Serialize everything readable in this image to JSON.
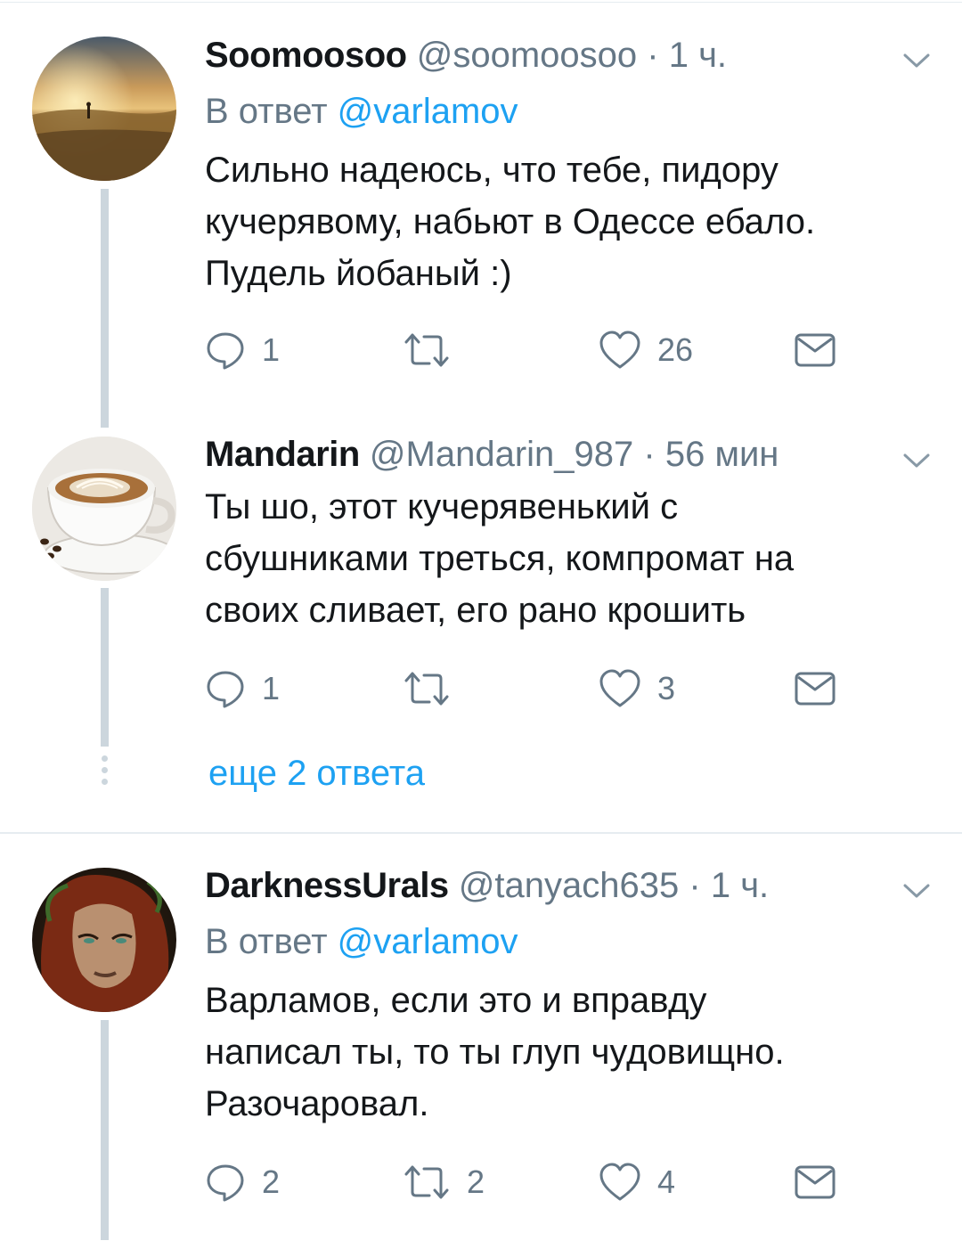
{
  "colors": {
    "text": "#14171a",
    "secondary": "#657786",
    "link": "#1da1f2",
    "thread_line": "#ccd6dd",
    "divider": "#e6ecf0"
  },
  "tweets": [
    {
      "display_name": "Soomoosoo",
      "handle": "@soomoosoo",
      "separator": "·",
      "time": "1 ч.",
      "reply_prefix": "В ответ",
      "reply_mention": "@varlamov",
      "text_lines": [
        "Сильно надеюсь, что тебе, пидору",
        "кучерявому, набьют в Одессе ебало.",
        "Пудель йобаный :)"
      ],
      "reply_count": "1",
      "retweet_count": "",
      "like_count": "26",
      "icons": [
        "reply-icon",
        "retweet-icon",
        "like-icon",
        "direct-message-icon",
        "chevron-down-icon"
      ]
    },
    {
      "display_name": "Mandarin",
      "handle": "@Mandarin_987",
      "separator": "·",
      "time": "56 мин",
      "text_lines": [
        "Ты шо, этот кучерявенький с",
        "сбушниками треться, компромат на",
        "своих сливает, его рано крошить"
      ],
      "reply_count": "1",
      "retweet_count": "",
      "like_count": "3"
    },
    {
      "display_name": "DarknessUrals",
      "handle": "@tanyach635",
      "separator": "·",
      "time": "1 ч.",
      "reply_prefix": "В ответ",
      "reply_mention": "@varlamov",
      "text_lines": [
        "Варламов, если это и вправду",
        "написал ты, то ты глуп чудовищно.",
        "Разочаровал."
      ],
      "reply_count": "2",
      "retweet_count": "2",
      "like_count": "4"
    }
  ],
  "more_replies": "еще 2 ответа"
}
